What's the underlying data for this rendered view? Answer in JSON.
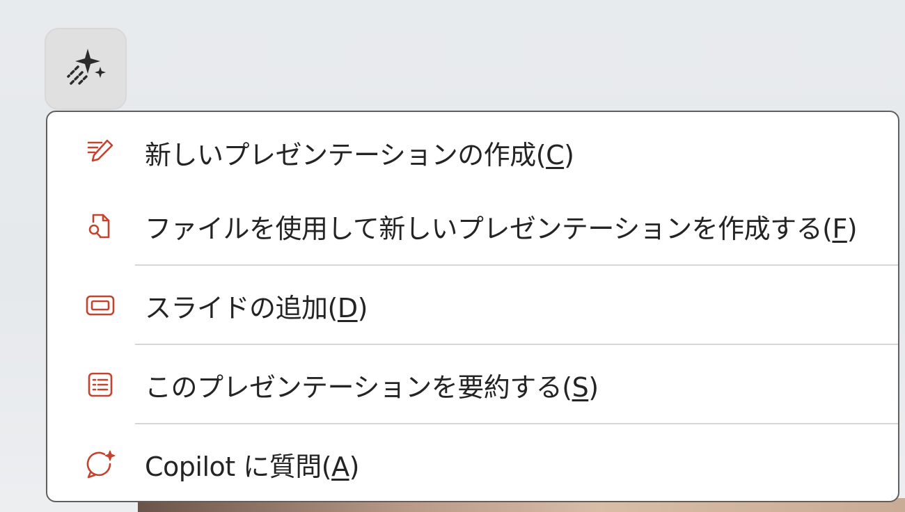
{
  "copilot_button": {
    "icon": "copilot-sparkle-icon"
  },
  "menu": {
    "accent_color": "#c4432f",
    "items": [
      {
        "icon": "pen-lines-icon",
        "prefix": "新しいプレゼンテーションの作成(",
        "accel": "C",
        "suffix": ")"
      },
      {
        "icon": "file-search-icon",
        "prefix": "ファイルを使用して新しいプレゼンテーションを作成する(",
        "accel": "F",
        "suffix": ")"
      },
      {
        "icon": "slide-icon",
        "prefix": "スライドの追加(",
        "accel": "D",
        "suffix": ")"
      },
      {
        "icon": "summary-list-icon",
        "prefix": "このプレゼンテーションを要約する(",
        "accel": "S",
        "suffix": ")"
      },
      {
        "icon": "chat-sparkle-icon",
        "prefix": "Copilot に質問(",
        "accel": "A",
        "suffix": ")"
      }
    ]
  }
}
